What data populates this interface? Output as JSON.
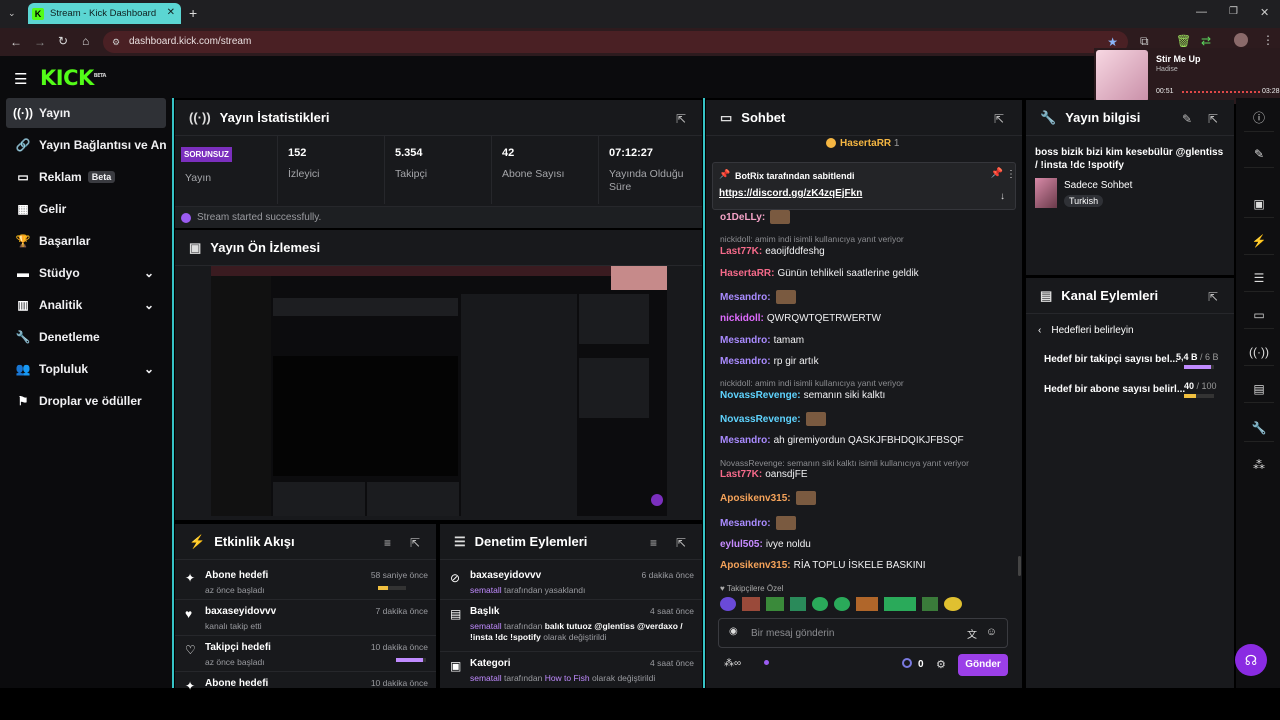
{
  "browser": {
    "tab_title": "Stream - Kick Dashboard",
    "url": "dashboard.kick.com/stream"
  },
  "media": {
    "title": "Stir Me Up",
    "artist": "Hadise",
    "elapsed": "00:51",
    "duration": "03:28"
  },
  "brand": {
    "logo": "KICK",
    "logo_sup": "BETA",
    "accent": "#53fc18"
  },
  "sidebar": {
    "items": [
      {
        "label": "Yayın"
      },
      {
        "label": "Yayın Bağlantısı ve Anahtar"
      },
      {
        "label": "Reklam",
        "badge": "Beta"
      },
      {
        "label": "Gelir"
      },
      {
        "label": "Başarılar"
      },
      {
        "label": "Stüdyo"
      },
      {
        "label": "Analitik"
      },
      {
        "label": "Denetleme"
      },
      {
        "label": "Topluluk"
      },
      {
        "label": "Droplar ve ödüller"
      }
    ]
  },
  "stats": {
    "title": "Yayın İstatistikleri",
    "status_badge": "SORUNSUZ",
    "status_label": "Yayın",
    "items": [
      {
        "value": "152",
        "label": "İzleyici"
      },
      {
        "value": "5.354",
        "label": "Takipçi"
      },
      {
        "value": "42",
        "label": "Abone Sayısı"
      },
      {
        "value": "07:12:27",
        "label": "Yayında Olduğu Süre"
      }
    ],
    "success": "Stream started successfully."
  },
  "preview": {
    "title": "Yayın Ön İzlemesi"
  },
  "events": {
    "title": "Etkinlik Akışı",
    "rows": [
      {
        "title": "Abone hedefi",
        "sub": "az önce başladı",
        "time": "58 saniye önce",
        "progress": 0.35
      },
      {
        "title": "baxaseyidovvv",
        "sub": "kanalı takip etti",
        "time": "7 dakika önce"
      },
      {
        "title": "Takipçi hedefi",
        "sub": "az önce başladı",
        "time": "10 dakika önce",
        "progress": 0.9
      },
      {
        "title": "Abone hedefi",
        "sub": "",
        "time": "10 dakika önce"
      }
    ]
  },
  "moderation": {
    "title": "Denetim Eylemleri",
    "rows": [
      {
        "title": "baxaseyidovvv",
        "actor": "sematall",
        "rest": "tarafından yasaklandı",
        "time": "6 dakika önce"
      },
      {
        "title": "Başlık",
        "actor": "sematall",
        "mid": "tarafından",
        "val": "balık tutuoz @glentiss @verdaxo / !insta !dc !spotify",
        "rest": "olarak değiştirildi",
        "time": "4 saat önce"
      },
      {
        "title": "Kategori",
        "actor": "sematall",
        "mid": "tarafından",
        "val": "How to Fish",
        "rest": "olarak değiştirildi",
        "time": "4 saat önce"
      }
    ]
  },
  "chat": {
    "title": "Sohbet",
    "top_user": "HasertaRR",
    "top_count": "1",
    "pinned_by": "BotRix tarafından sabitlendi",
    "pinned_link": "https://discord.gg/zK4zqEjFkn",
    "messages": [
      {
        "kind": "msg",
        "user": "o1DeLLy",
        "color": "#f5a3c7",
        "text": ""
      },
      {
        "kind": "reply",
        "text": "nickidoll: amim indi isimli kullanıcıya yanıt veriyor"
      },
      {
        "kind": "msg",
        "user": "Last77K",
        "color": "#f56a8a",
        "text": "eaoijfddfeshg"
      },
      {
        "kind": "msg",
        "user": "HasertaRR",
        "color": "#f56a8a",
        "text": "Günün tehlikeli saatlerine geldik"
      },
      {
        "kind": "msg",
        "user": "Mesandro",
        "color": "#a98bff",
        "text": ""
      },
      {
        "kind": "msg",
        "user": "nickidoll",
        "color": "#e06cff",
        "text": "QWRQWTQETRWERTW"
      },
      {
        "kind": "msg",
        "user": "Mesandro",
        "color": "#a98bff",
        "text": "tamam"
      },
      {
        "kind": "msg",
        "user": "Mesandro",
        "color": "#a98bff",
        "text": "rp gir artık"
      },
      {
        "kind": "reply",
        "text": "nickidoll: amim indi isimli kullanıcıya yanıt veriyor"
      },
      {
        "kind": "msg",
        "user": "NovassRevenge",
        "color": "#5fd4ff",
        "text": "semanın siki kalktı"
      },
      {
        "kind": "msg",
        "user": "NovassRevenge",
        "color": "#5fd4ff",
        "text": ""
      },
      {
        "kind": "msg",
        "user": "Mesandro",
        "color": "#a98bff",
        "text": "ah giremiyordun QASKJFBHDQIKJFBSQF"
      },
      {
        "kind": "reply",
        "text": "NovassRevenge: semanın siki kalktı isimli kullanıcıya yanıt veriyor"
      },
      {
        "kind": "msg",
        "user": "Last77K",
        "color": "#f56a8a",
        "text": "oansdjFE"
      },
      {
        "kind": "msg",
        "user": "Aposikenv315",
        "color": "#f5a35a",
        "text": ""
      },
      {
        "kind": "msg",
        "user": "Mesandro",
        "color": "#a98bff",
        "text": ""
      },
      {
        "kind": "msg",
        "user": "eylul505",
        "color": "#c78bff",
        "text": "ivye noldu"
      },
      {
        "kind": "msg",
        "user": "Aposikenv315",
        "color": "#f5a35a",
        "text": "RİA TOPLU İSKELE BASKINI"
      }
    ],
    "emote_label": "Takipçilere Özel",
    "input_placeholder": "Bir mesaj gönderin",
    "points": "0",
    "send": "Gönder"
  },
  "info": {
    "title": "Yayın bilgisi",
    "stream_title": "boss bizik bizi kim kesebülür @glentiss / !insta !dc !spotify",
    "category": "Sadece Sohbet",
    "tag": "Turkish"
  },
  "channel_actions": {
    "title": "Kanal Eylemleri",
    "back": "Hedefleri belirleyin",
    "goals": [
      {
        "label": "Hedef bir takipçi sayısı bel...",
        "value": "5,4 B",
        "target": "/ 6 B",
        "progress": 0.9
      },
      {
        "label": "Hedef bir abone sayısı belirl...",
        "value": "40",
        "target": "/ 100",
        "progress": 0.4
      }
    ]
  }
}
